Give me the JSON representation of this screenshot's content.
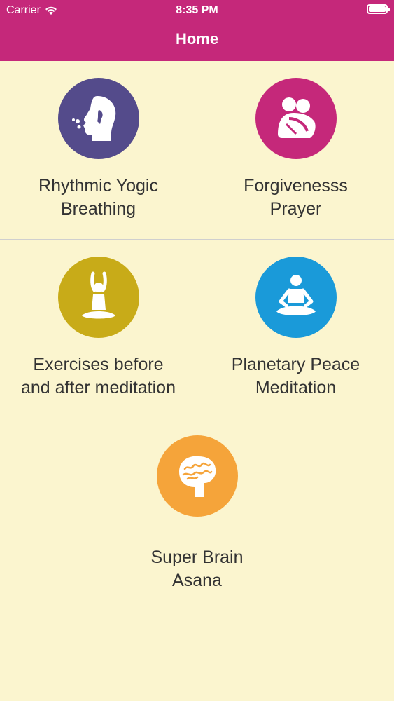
{
  "status_bar": {
    "carrier": "Carrier",
    "time": "8:35 PM"
  },
  "header": {
    "title": "Home"
  },
  "colors": {
    "header_bg": "#c5287a",
    "page_bg": "#fbf5cf",
    "breathing": "#544b8b",
    "forgiveness": "#c5287a",
    "exercises": "#c8ab18",
    "meditation": "#1a9ad9",
    "brain": "#f5a43a"
  },
  "items": [
    {
      "line1": "Rhythmic Yogic",
      "line2": "Breathing",
      "icon": "breathing-icon"
    },
    {
      "line1": "Forgivenesss",
      "line2": "Prayer",
      "icon": "hug-icon"
    },
    {
      "line1": "Exercises before",
      "line2": "and after meditation",
      "icon": "yoga-pose-icon"
    },
    {
      "line1": "Planetary Peace",
      "line2": "Meditation",
      "icon": "meditation-icon"
    },
    {
      "line1": "Super Brain",
      "line2": "Asana",
      "icon": "brain-icon"
    }
  ]
}
